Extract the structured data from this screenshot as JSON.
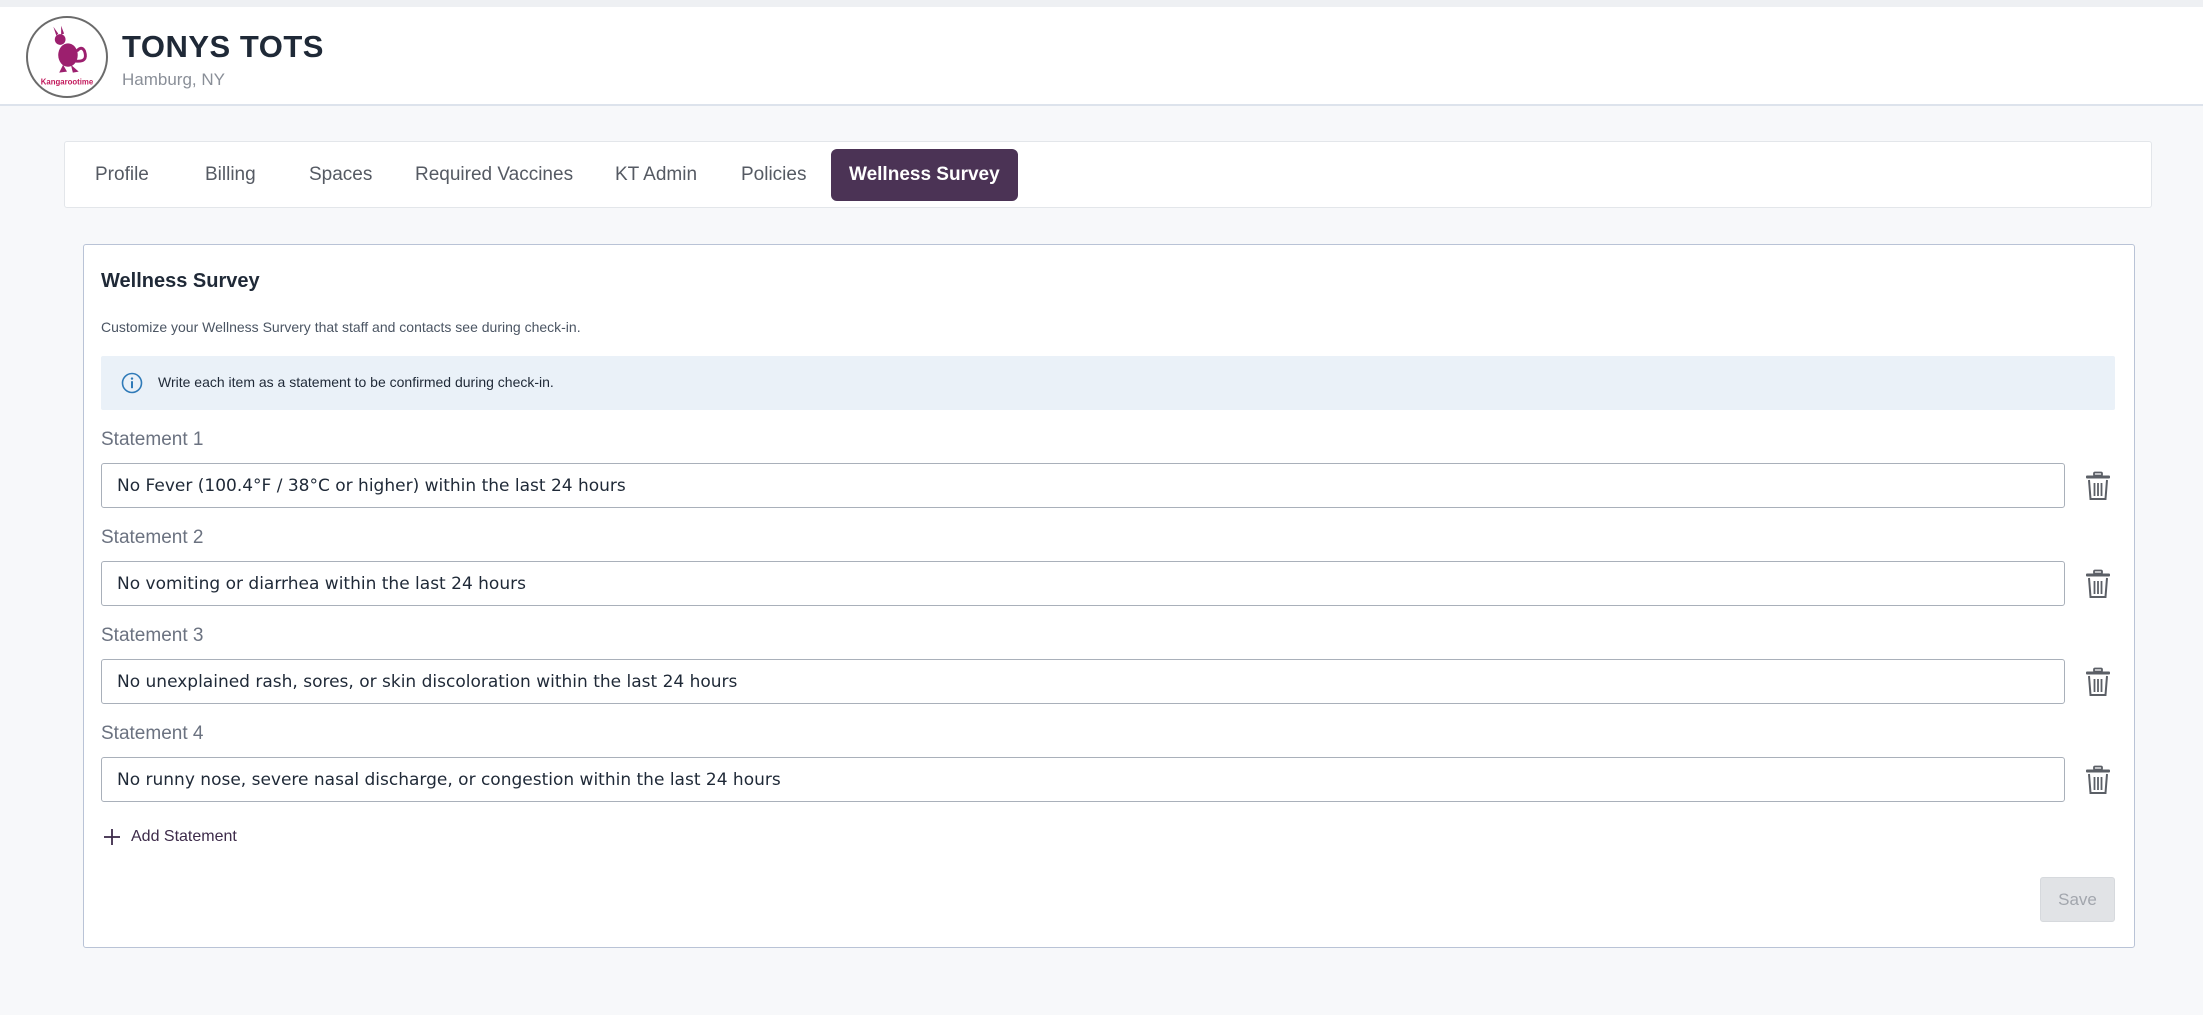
{
  "header": {
    "logo_text": "Kangarootime",
    "org_name": "TONYS TOTS",
    "location": "Hamburg, NY"
  },
  "tabs": [
    {
      "label": "Profile",
      "active": false
    },
    {
      "label": "Billing",
      "active": false
    },
    {
      "label": "Spaces",
      "active": false
    },
    {
      "label": "Required Vaccines",
      "active": false
    },
    {
      "label": "KT Admin",
      "active": false
    },
    {
      "label": "Policies",
      "active": false
    },
    {
      "label": "Wellness Survey",
      "active": true
    }
  ],
  "survey": {
    "title": "Wellness Survey",
    "description": "Customize your Wellness Survery that staff and contacts see during check-in.",
    "info": "Write each item as a statement to be confirmed during check-in.",
    "statements": [
      {
        "label": "Statement 1",
        "value": "No Fever (100.4°F / 38°C or higher) within the last 24 hours"
      },
      {
        "label": "Statement 2",
        "value": "No vomiting or diarrhea within the last 24 hours"
      },
      {
        "label": "Statement 3",
        "value": "No unexplained rash, sores, or skin discoloration within the last 24 hours"
      },
      {
        "label": "Statement 4",
        "value": "No runny nose, severe nasal discharge, or congestion within the last 24 hours"
      }
    ],
    "add_label": "Add Statement",
    "save_label": "Save"
  },
  "colors": {
    "accent": "#4b3355",
    "logo_magenta": "#c2185b",
    "info_bg": "#eaf1f8",
    "info_icon": "#2f7ab8"
  }
}
